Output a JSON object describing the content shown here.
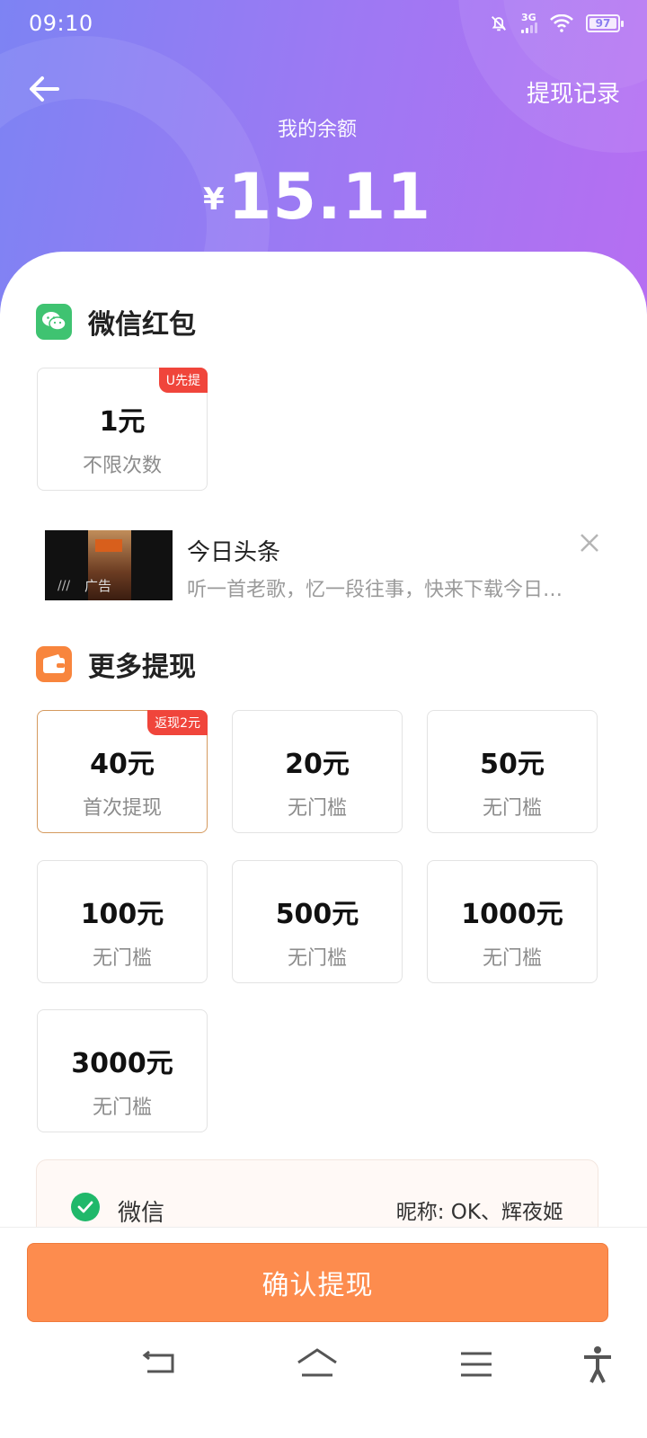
{
  "status_bar": {
    "time": "09:10",
    "network": "3G",
    "battery": "97"
  },
  "header": {
    "record_link": "提现记录",
    "balance_label": "我的余额",
    "currency_symbol": "¥",
    "balance": "15.11"
  },
  "wechat_section": {
    "title": "微信红包",
    "options": [
      {
        "value": "1元",
        "sub": "不限次数",
        "tag": "U先提"
      }
    ]
  },
  "ad": {
    "title": "今日头条",
    "description": "听一首老歌，忆一段往事，快来下载今日…",
    "thumb_label": "广告"
  },
  "more_section": {
    "title": "更多提现",
    "options": [
      {
        "value": "40元",
        "sub": "首次提现",
        "tag": "返现2元",
        "selected": true
      },
      {
        "value": "20元",
        "sub": "无门槛"
      },
      {
        "value": "50元",
        "sub": "无门槛"
      },
      {
        "value": "100元",
        "sub": "无门槛"
      },
      {
        "value": "500元",
        "sub": "无门槛"
      },
      {
        "value": "1000元",
        "sub": "无门槛"
      },
      {
        "value": "3000元",
        "sub": "无门槛"
      }
    ]
  },
  "payment": {
    "method": "微信",
    "nickname": "昵称: OK、辉夜姬"
  },
  "confirm_button": "确认提现",
  "colors": {
    "header_start": "#7d83f3",
    "header_end": "#b66ef2",
    "accent": "#fd8c4e",
    "tag": "#f0453b",
    "wechat_green": "#20b86a"
  }
}
